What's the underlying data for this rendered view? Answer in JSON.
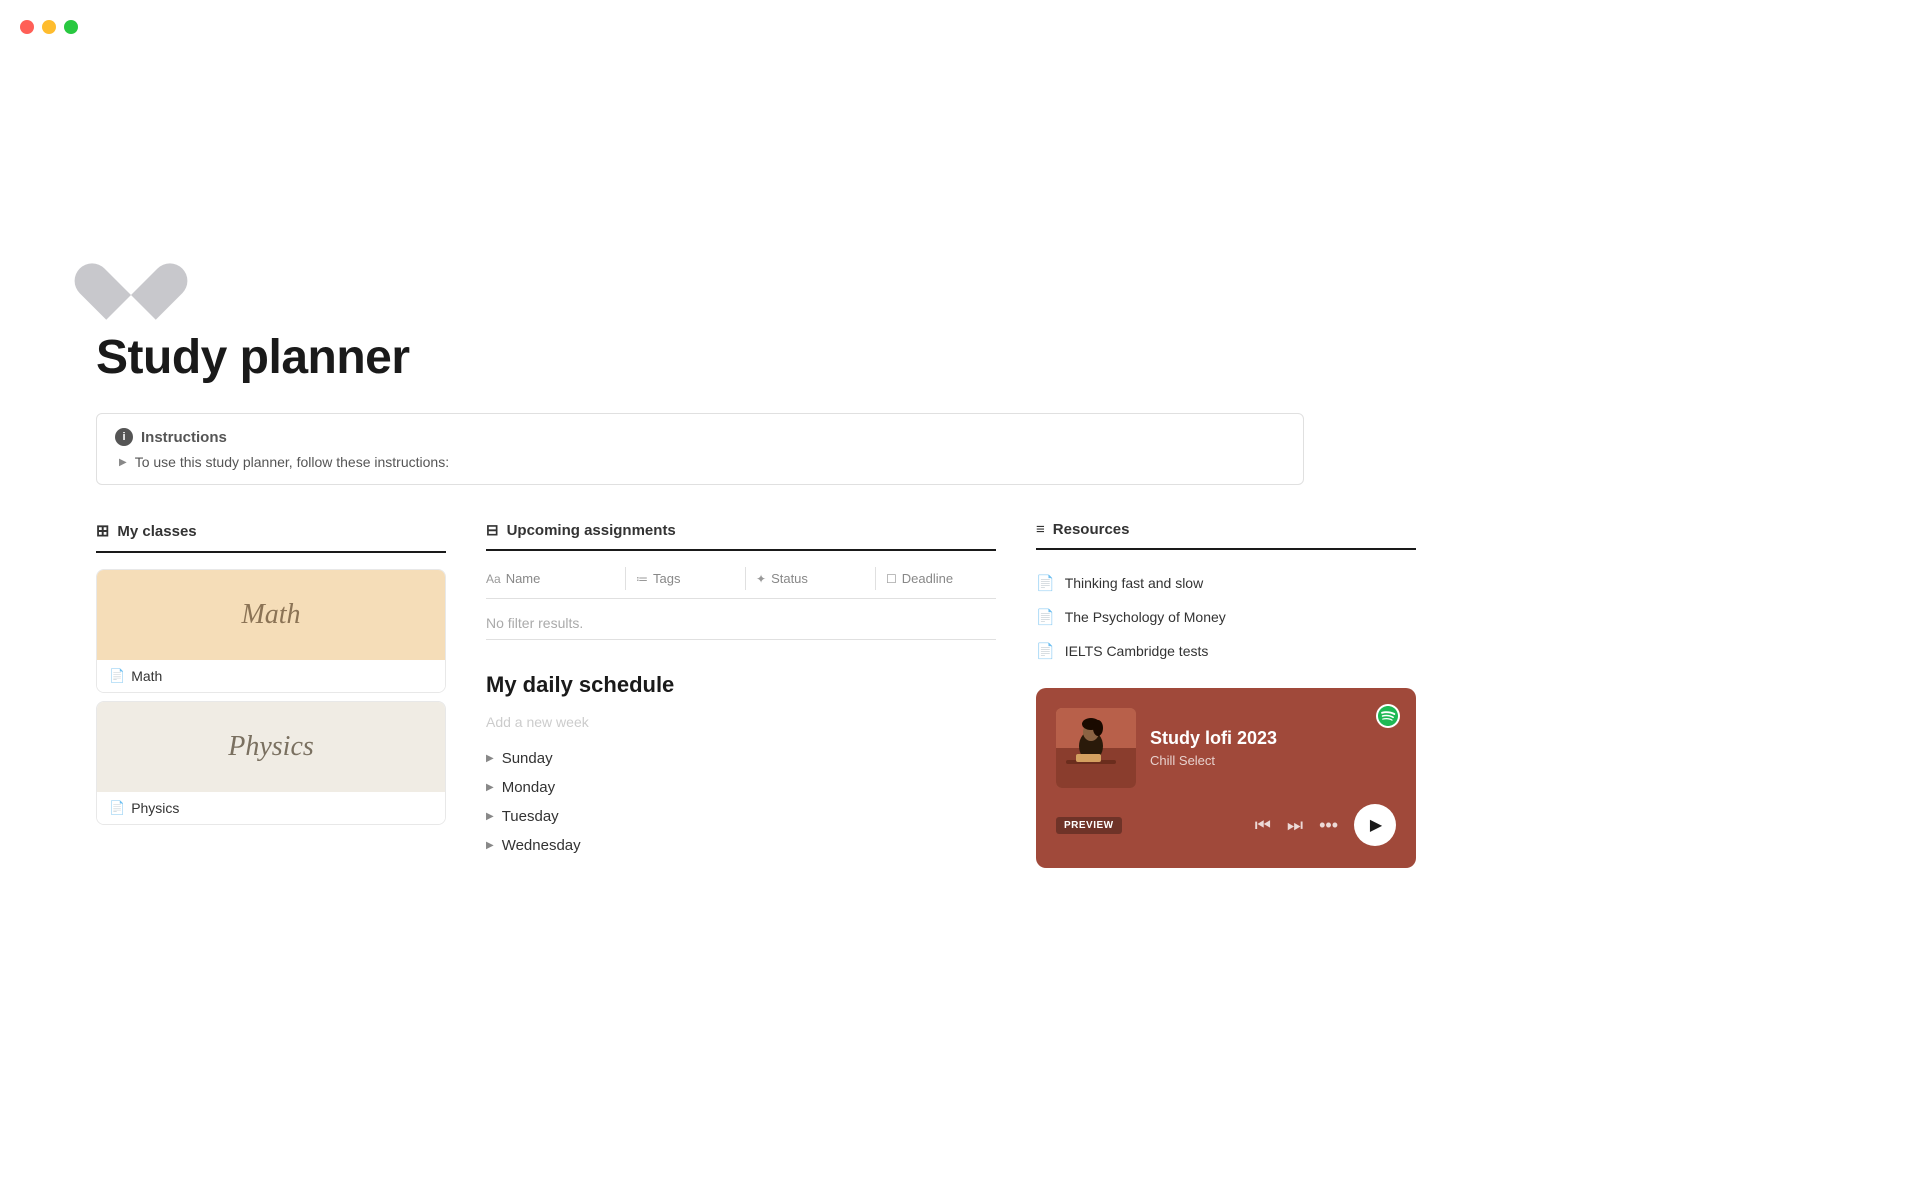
{
  "window": {
    "traffic_lights": {
      "red_label": "close",
      "yellow_label": "minimize",
      "green_label": "maximize"
    }
  },
  "page": {
    "icon": "🤍",
    "title": "Study planner"
  },
  "instructions": {
    "header": "Instructions",
    "body": "To use this study planner, follow these instructions:"
  },
  "classes": {
    "section_label": "My classes",
    "items": [
      {
        "name": "Math",
        "style": "math"
      },
      {
        "name": "Physics",
        "style": "physics"
      }
    ]
  },
  "assignments": {
    "section_label": "Upcoming assignments",
    "columns": [
      "Name",
      "Tags",
      "Status",
      "Deadline"
    ],
    "no_results": "No filter results.",
    "column_icons": [
      "text",
      "list",
      "sparkle",
      "calendar"
    ]
  },
  "schedule": {
    "title": "My daily schedule",
    "add_week_placeholder": "Add a new week",
    "days": [
      "Sunday",
      "Monday",
      "Tuesday",
      "Wednesday"
    ]
  },
  "resources": {
    "section_label": "Resources",
    "items": [
      "Thinking fast and slow",
      "The Psychology of Money",
      "IELTS Cambridge tests"
    ]
  },
  "spotify": {
    "preview_label": "PREVIEW",
    "track_name": "Study lofi 2023",
    "artist": "Chill Select"
  }
}
